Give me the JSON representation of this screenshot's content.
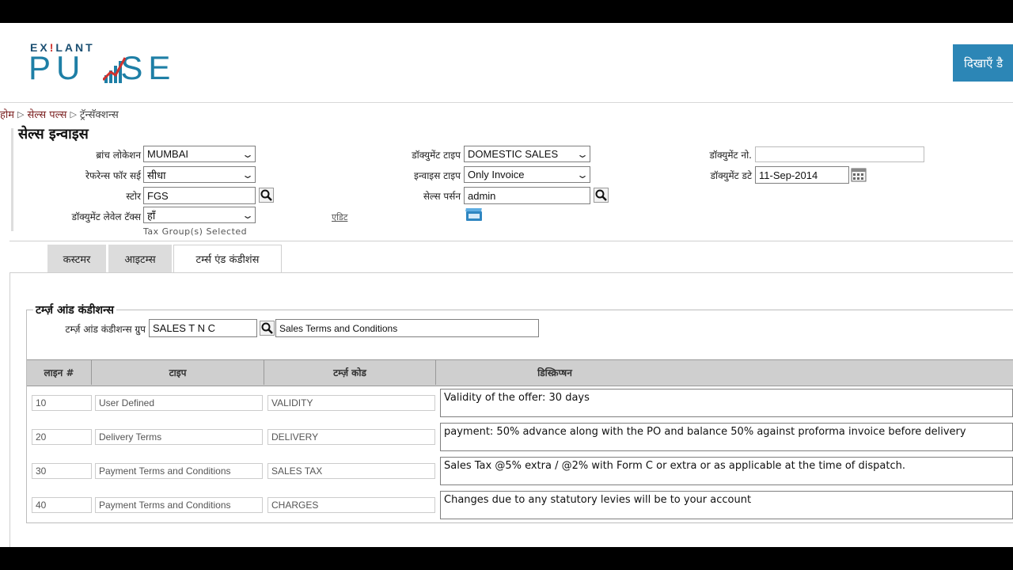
{
  "header": {
    "logo_top_a": "EX",
    "logo_top_b": "!",
    "logo_top_c": "LANT",
    "logo_main_a": "PU",
    "logo_main_b": "SE",
    "show_button": "दिखाएँ डै"
  },
  "breadcrumb": [
    "होम",
    "सेल्स पल्स",
    "ट्रॅन्सॅक्शन्स"
  ],
  "page_title": "सेल्स इन्वाइस",
  "form": {
    "branch_location": {
      "label": "ब्रांच लोकेशन",
      "value": "MUMBAI"
    },
    "document_type": {
      "label": "डॉक्युमेंट टाइप",
      "value": "DOMESTIC SALES"
    },
    "document_no": {
      "label": "डॉक्युमेंट नो.",
      "value": ""
    },
    "reference_for_sale": {
      "label": "रेफरेन्स फॉर सई",
      "value": "सीधा"
    },
    "invoice_type": {
      "label": "इन्वाइस टाइप",
      "value": "Only Invoice"
    },
    "document_date": {
      "label": "डॉक्युमेंट डटे",
      "value": "11-Sep-2014"
    },
    "store": {
      "label": "स्टोर",
      "value": "FGS"
    },
    "sales_person": {
      "label": "सेल्स पर्सन",
      "value": "admin"
    },
    "document_level_tax": {
      "label": "डॉक्युमेंट लेवेल टॅक्स",
      "value": "हाँ"
    },
    "edit_link": "एडिट",
    "tax_note": "Tax Group(s) Selected"
  },
  "tabs": [
    "कस्टमर",
    "आइटम्स",
    "टर्म्स एंड कंडीशंस"
  ],
  "terms": {
    "legend": "टर्म्ज़ आंड कंडीशन्स",
    "group_label": "टर्म्ज़ आंड कंडीशन्स ग्रुप",
    "group_code": "SALES T N C",
    "group_name": "Sales Terms and Conditions",
    "columns": [
      "लाइन #",
      "टाइप",
      "टर्म्ज़ कोड",
      "डिस्क्रिप्षन"
    ],
    "rows": [
      {
        "line": "10",
        "type": "User Defined",
        "code": "VALIDITY",
        "description": "Validity of the offer: 30 days"
      },
      {
        "line": "20",
        "type": "Delivery Terms",
        "code": "DELIVERY",
        "description": "payment: 50% advance along with the PO and balance 50% against proforma invoice before delivery"
      },
      {
        "line": "30",
        "type": "Payment Terms and Conditions",
        "code": "SALES TAX",
        "description": "Sales Tax @5% extra / @2% with Form C or extra or as applicable at the time of dispatch."
      },
      {
        "line": "40",
        "type": "Payment Terms and Conditions",
        "code": "CHARGES",
        "description": "Changes due to any statutory levies will be to your account"
      }
    ]
  },
  "colors": {
    "brand": "#1e7fa6",
    "button": "#2c86b6",
    "breadcrumb": "#7a1f1f"
  }
}
